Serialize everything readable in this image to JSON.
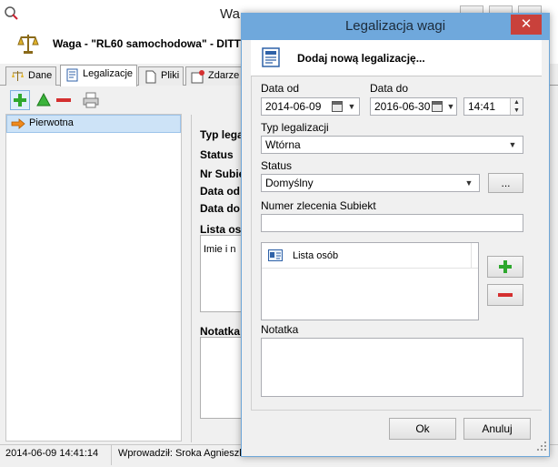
{
  "background_window": {
    "title": "Wa",
    "header": "Waga - \"RL60 samochodowa\" - DITT",
    "tabs": [
      {
        "label": "Dane",
        "icon": "scale-icon"
      },
      {
        "label": "Legalizacje",
        "icon": "document-icon"
      },
      {
        "label": "Pliki",
        "icon": "file-icon"
      },
      {
        "label": "Zdarze",
        "icon": "event-icon"
      }
    ],
    "toolbar": [
      {
        "icon": "plus-icon"
      },
      {
        "icon": "triangle-up-icon"
      },
      {
        "icon": "minus-icon"
      },
      {
        "icon": "printer-icon"
      }
    ],
    "tree": [
      {
        "label": "Pierwotna"
      }
    ],
    "details": {
      "type_label": "Typ lega",
      "status_label": "Status",
      "subject_no_label": "Nr Subie",
      "date_from_label": "Data od",
      "date_to_label": "Data do",
      "persons_label": "Lista os",
      "persons_column": "Imie i n",
      "note_label": "Notatka"
    },
    "statusbar": {
      "date": "2014-06-09 14:41:14",
      "author": "Wprowadził: Sroka Agnieszka"
    }
  },
  "dialog": {
    "title": "Legalizacja wagi",
    "close_glyph": "✕",
    "header": "Dodaj nową legalizację...",
    "date_from": {
      "label": "Data od",
      "value": "2014-06-09"
    },
    "date_to": {
      "label": "Data do",
      "value": "2016-06-30"
    },
    "time": {
      "value": "14:41"
    },
    "type": {
      "label": "Typ legalizacji",
      "value": "Wtórna"
    },
    "status": {
      "label": "Status",
      "value": "Domyślny",
      "browse_label": "..."
    },
    "order_no": {
      "label": "Numer zlecenia Subiekt",
      "value": ""
    },
    "persons": {
      "column": "Lista osób"
    },
    "note": {
      "label": "Notatka",
      "value": ""
    },
    "ok_label": "Ok",
    "cancel_label": "Anuluj"
  },
  "colors": {
    "dialog_title_bar": "#6fa8dc",
    "close_button": "#c9413b",
    "selection": "#cde3f7",
    "add_green": "#2ea82e",
    "remove_red": "#d42f2f"
  }
}
